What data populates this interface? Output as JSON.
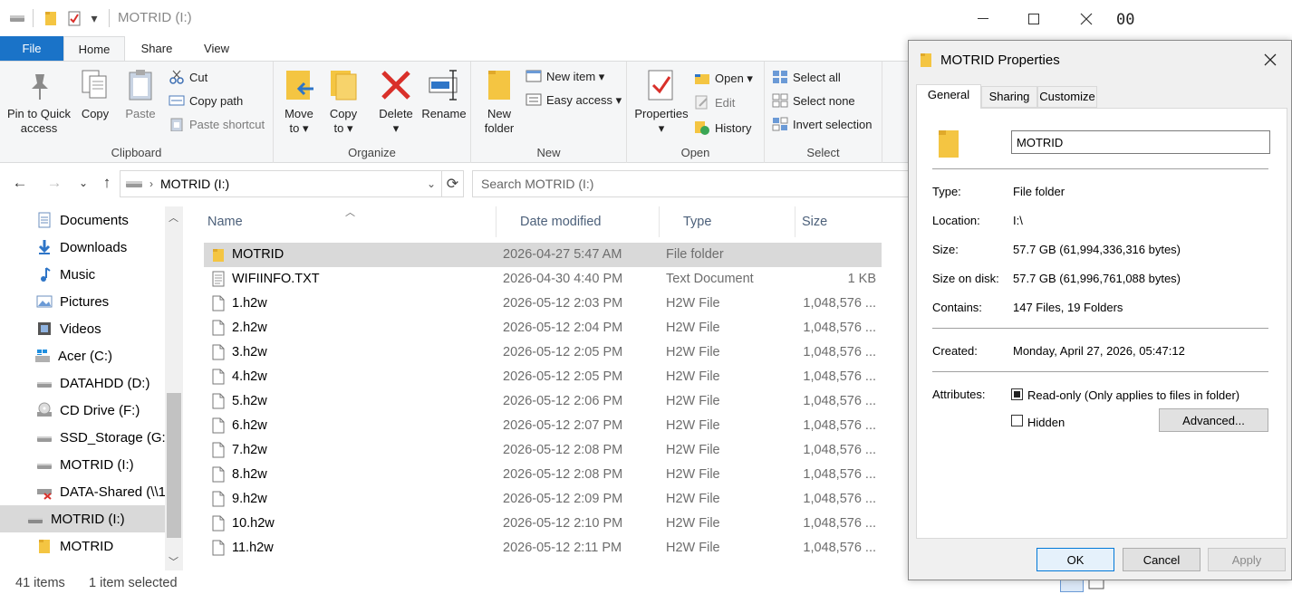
{
  "titlebar": {
    "title": "MOTRID (I:)",
    "qa_dropdown": "▾"
  },
  "tabs": {
    "file": "File",
    "home": "Home",
    "share": "Share",
    "view": "View"
  },
  "ribbon": {
    "clipboard": {
      "label": "Clipboard",
      "pin_line1": "Pin to Quick",
      "pin_line2": "access",
      "copy": "Copy",
      "paste": "Paste",
      "cut": "Cut",
      "copy_path": "Copy path",
      "paste_shortcut": "Paste shortcut"
    },
    "organize": {
      "label": "Organize",
      "move_to_1": "Move",
      "move_to_2": "to ▾",
      "copy_to_1": "Copy",
      "copy_to_2": "to ▾",
      "delete_1": "Delete",
      "delete_2": "▾",
      "rename": "Rename"
    },
    "new": {
      "label": "New",
      "new_folder_1": "New",
      "new_folder_2": "folder",
      "new_item": "New item ▾",
      "easy_access": "Easy access ▾"
    },
    "open": {
      "label": "Open",
      "properties_1": "Properties",
      "properties_2": "▾",
      "open": "Open ▾",
      "edit": "Edit",
      "history": "History"
    },
    "select": {
      "label": "Select",
      "select_all": "Select all",
      "select_none": "Select none",
      "invert": "Invert selection"
    }
  },
  "address": {
    "path": "MOTRID (I:)",
    "search_placeholder": "Search MOTRID (I:)"
  },
  "nav": {
    "items": [
      {
        "label": "Documents",
        "icon": "documents-icon"
      },
      {
        "label": "Downloads",
        "icon": "downloads-icon"
      },
      {
        "label": "Music",
        "icon": "music-icon"
      },
      {
        "label": "Pictures",
        "icon": "pictures-icon"
      },
      {
        "label": "Videos",
        "icon": "videos-icon"
      },
      {
        "label": "Acer (C:)",
        "icon": "windows-drive-icon"
      },
      {
        "label": "DATAHDD (D:)",
        "icon": "drive-icon"
      },
      {
        "label": "CD Drive (F:)",
        "icon": "cd-drive-icon"
      },
      {
        "label": "SSD_Storage (G:)",
        "icon": "drive-icon"
      },
      {
        "label": "MOTRID (I:)",
        "icon": "drive-icon"
      },
      {
        "label": "DATA-Shared (\\\\1",
        "icon": "network-drive-disconnected-icon"
      },
      {
        "label": "MOTRID (I:)",
        "icon": "usb-drive-icon"
      },
      {
        "label": "MOTRID",
        "icon": "folder-icon"
      }
    ]
  },
  "columns": {
    "name": "Name",
    "date": "Date modified",
    "type": "Type",
    "size": "Size"
  },
  "files": [
    {
      "name": "MOTRID",
      "date": "2026-04-27 5:47 AM",
      "type": "File folder",
      "size": ""
    },
    {
      "name": "WIFIINFO.TXT",
      "date": "2026-04-30 4:40 PM",
      "type": "Text Document",
      "size": "1 KB"
    },
    {
      "name": "1.h2w",
      "date": "2026-05-12 2:03 PM",
      "type": "H2W File",
      "size": "1,048,576 ..."
    },
    {
      "name": "2.h2w",
      "date": "2026-05-12 2:04 PM",
      "type": "H2W File",
      "size": "1,048,576 ..."
    },
    {
      "name": "3.h2w",
      "date": "2026-05-12 2:05 PM",
      "type": "H2W File",
      "size": "1,048,576 ..."
    },
    {
      "name": "4.h2w",
      "date": "2026-05-12 2:05 PM",
      "type": "H2W File",
      "size": "1,048,576 ..."
    },
    {
      "name": "5.h2w",
      "date": "2026-05-12 2:06 PM",
      "type": "H2W File",
      "size": "1,048,576 ..."
    },
    {
      "name": "6.h2w",
      "date": "2026-05-12 2:07 PM",
      "type": "H2W File",
      "size": "1,048,576 ..."
    },
    {
      "name": "7.h2w",
      "date": "2026-05-12 2:08 PM",
      "type": "H2W File",
      "size": "1,048,576 ..."
    },
    {
      "name": "8.h2w",
      "date": "2026-05-12 2:08 PM",
      "type": "H2W File",
      "size": "1,048,576 ..."
    },
    {
      "name": "9.h2w",
      "date": "2026-05-12 2:09 PM",
      "type": "H2W File",
      "size": "1,048,576 ..."
    },
    {
      "name": "10.h2w",
      "date": "2026-05-12 2:10 PM",
      "type": "H2W File",
      "size": "1,048,576 ..."
    },
    {
      "name": "11.h2w",
      "date": "2026-05-12 2:11 PM",
      "type": "H2W File",
      "size": "1,048,576 ..."
    }
  ],
  "status": {
    "items": "41 items",
    "selected": "1 item selected"
  },
  "dialog": {
    "title": "MOTRID Properties",
    "tabs": {
      "general": "General",
      "sharing": "Sharing",
      "customize": "Customize"
    },
    "name_value": "MOTRID",
    "type_label": "Type:",
    "type_value": "File folder",
    "location_label": "Location:",
    "location_value": "I:\\",
    "size_label": "Size:",
    "size_value": "57.7 GB (61,994,336,316 bytes)",
    "size_on_disk_label": "Size on disk:",
    "size_on_disk_value": "57.7 GB (61,996,761,088 bytes)",
    "contains_label": "Contains:",
    "contains_value": "147 Files, 19 Folders",
    "created_label": "Created:",
    "created_value": "Monday, April 27, 2026, 05:47:12",
    "attributes_label": "Attributes:",
    "readonly_label": "Read-only (Only applies to files in folder)",
    "hidden_label": "Hidden",
    "advanced_button": "Advanced...",
    "ok": "OK",
    "cancel": "Cancel",
    "apply": "Apply"
  },
  "background_text": "00",
  "colors": {
    "accent": "#1a73c8",
    "selection": "#d9d9d9",
    "folder": "#f4c542"
  }
}
